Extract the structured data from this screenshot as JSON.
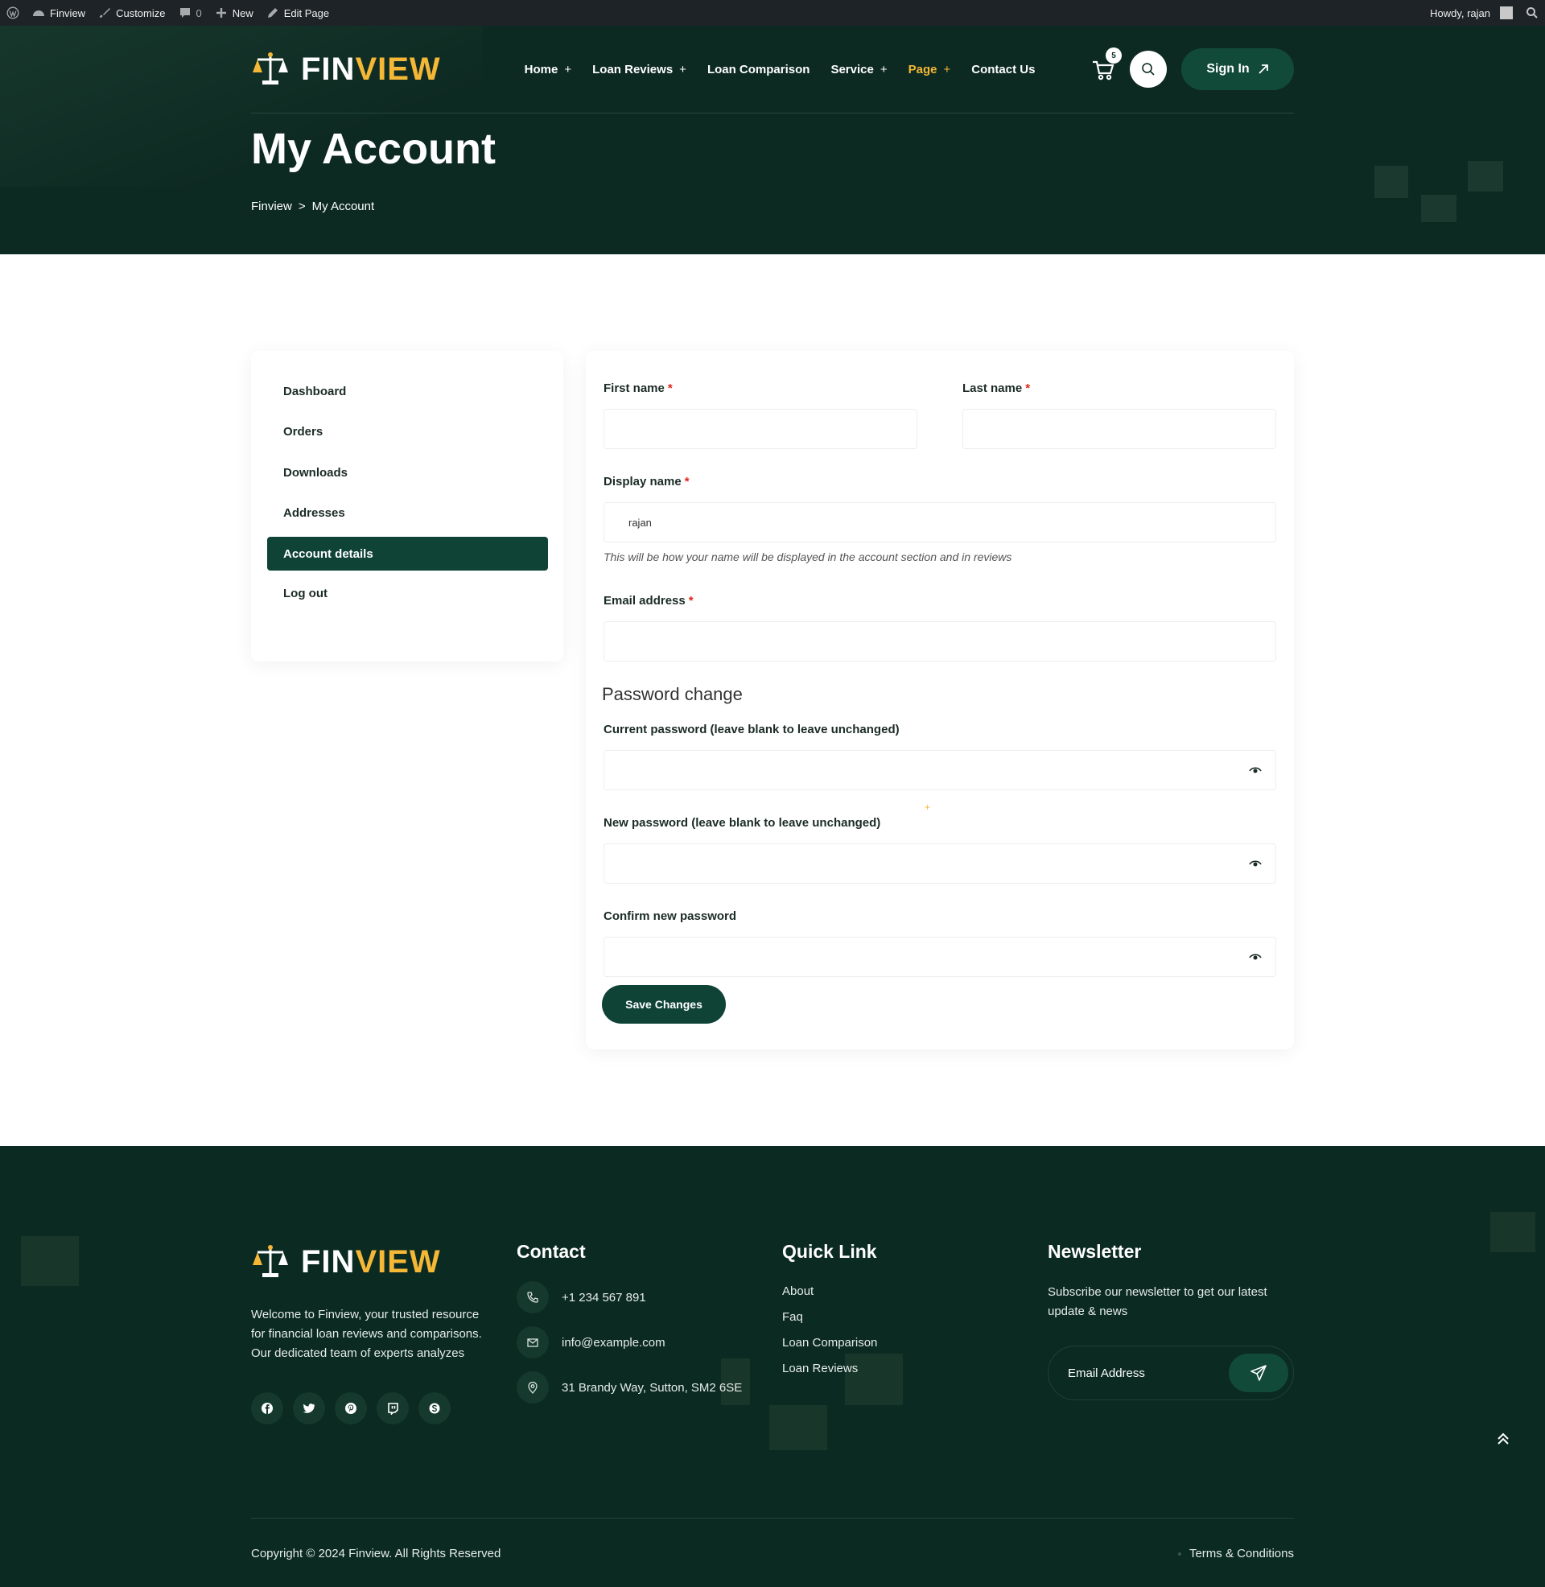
{
  "admin_bar": {
    "site": "Finview",
    "customize": "Customize",
    "comments": "0",
    "new": "New",
    "edit_page": "Edit Page",
    "howdy": "Howdy, rajan"
  },
  "header": {
    "logo_fin": "FIN",
    "logo_view": "VIEW",
    "nav": [
      {
        "label": "Home",
        "plus": "+"
      },
      {
        "label": "Loan Reviews",
        "plus": "+"
      },
      {
        "label": "Loan Comparison",
        "plus": ""
      },
      {
        "label": "Service",
        "plus": "+"
      },
      {
        "label": "Page",
        "plus": "+"
      },
      {
        "label": "Contact Us",
        "plus": ""
      }
    ],
    "cart_count": "5",
    "sign_in": "Sign In"
  },
  "hero": {
    "title": "My Account",
    "breadcrumb_home": "Finview",
    "breadcrumb_sep": ">",
    "breadcrumb_current": "My Account"
  },
  "account_nav": {
    "items": [
      "Dashboard",
      "Orders",
      "Downloads",
      "Addresses",
      "Account details",
      "Log out"
    ],
    "active": "Account details"
  },
  "form": {
    "first_name_label": "First name",
    "last_name_label": "Last name",
    "display_name_label": "Display name",
    "display_name_value": "rajan",
    "display_hint": "This will be how your name will be displayed in the account section and in reviews",
    "email_label": "Email address",
    "required_mark": "*",
    "password_heading": "Password change",
    "current_password_label": "Current password (leave blank to leave unchanged)",
    "new_password_label": "New password (leave blank to leave unchanged)",
    "confirm_password_label": "Confirm new password",
    "save_label": "Save Changes"
  },
  "footer": {
    "logo_fin": "FIN",
    "logo_view": "VIEW",
    "about": "Welcome to Finview, your trusted resource for financial loan reviews and comparisons. Our dedicated team of experts analyzes",
    "contact_heading": "Contact",
    "phone": "+1 234 567 891",
    "email": "info@example.com",
    "address": "31 Brandy Way, Sutton, SM2 6SE",
    "quick_heading": "Quick Link",
    "quick_links": [
      "About",
      "Faq",
      "Loan Comparison",
      "Loan Reviews"
    ],
    "newsletter_heading": "Newsletter",
    "newsletter_text": "Subscribe our newsletter to get our latest update & news",
    "newsletter_placeholder": "Email Address",
    "copyright": "Copyright © 2024 Finview. All Rights Reserved",
    "terms": "Terms & Conditions"
  },
  "colors": {
    "dark_green": "#0d2a22",
    "button_green": "#0f4336",
    "accent_gold": "#f4b736",
    "required_red": "#e2231a"
  },
  "icons": [
    "wordpress-icon",
    "cart-icon",
    "search-icon",
    "arrow-up-right-icon",
    "eye-icon",
    "phone-icon",
    "mail-icon",
    "location-icon",
    "send-icon",
    "facebook-icon",
    "twitter-icon",
    "pinterest-icon",
    "twitch-icon",
    "skype-icon",
    "chevron-up-icon"
  ]
}
